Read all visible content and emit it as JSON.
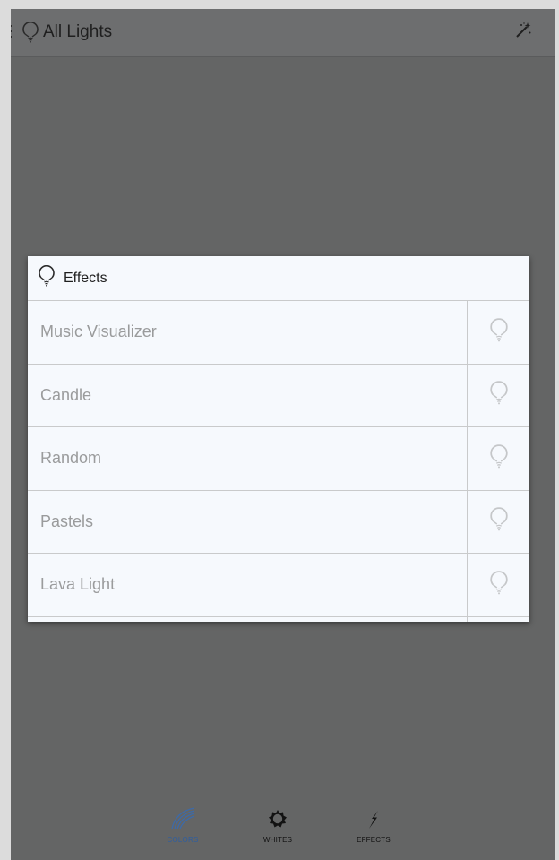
{
  "app_bar": {
    "title": "All Lights",
    "bulb_icon": "bulb-icon",
    "action_icon": "magic-wand-icon"
  },
  "dialog": {
    "title": "Effects",
    "header_icon": "bulb-icon",
    "items": [
      {
        "label": "Music Visualizer",
        "action_icon": "bulb-icon"
      },
      {
        "label": "Candle",
        "action_icon": "bulb-icon"
      },
      {
        "label": "Random",
        "action_icon": "bulb-icon"
      },
      {
        "label": "Pastels",
        "action_icon": "bulb-icon"
      },
      {
        "label": "Lava Light",
        "action_icon": "bulb-icon"
      }
    ]
  },
  "bottom_nav": {
    "tabs": [
      {
        "label": "COLORS",
        "icon": "rainbow-icon",
        "selected": true
      },
      {
        "label": "WHITES",
        "icon": "sun-icon",
        "selected": false
      },
      {
        "label": "EFFECTS",
        "icon": "lightning-icon",
        "selected": false
      }
    ]
  },
  "colors": {
    "scrim": "#646565",
    "dialog_bg": "#f6f9fd",
    "accent": "#2e5ea0"
  }
}
